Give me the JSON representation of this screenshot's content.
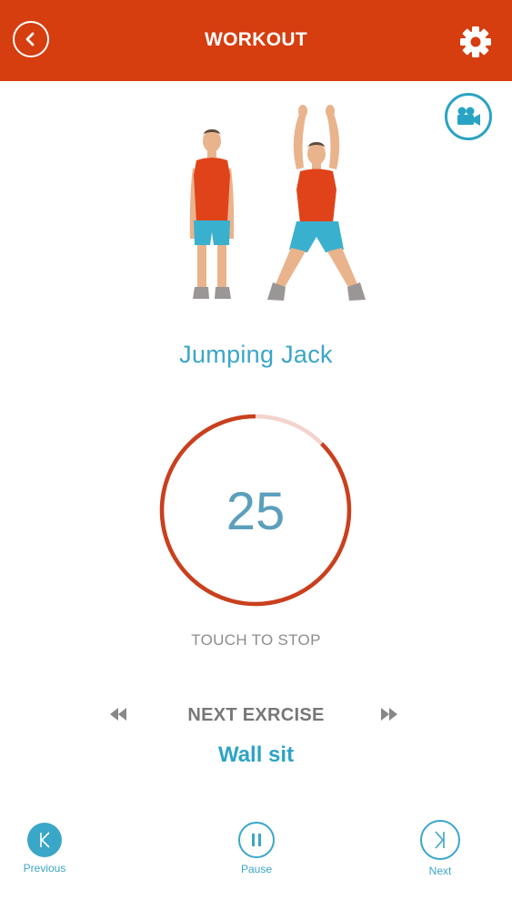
{
  "header": {
    "title": "WORKOUT",
    "background": "#d63d0f",
    "back_icon": "chevron-left-icon",
    "settings_icon": "gear-icon"
  },
  "video_button": {
    "icon": "video-camera-icon",
    "color": "#29a3c4"
  },
  "exercise": {
    "name": "Jumping Jack",
    "timer_value": "25",
    "timer_progress": 0.875,
    "touch_label": "TOUCH TO STOP"
  },
  "next": {
    "label": "NEXT EXRCISE",
    "name": "Wall sit",
    "prev_icon": "rewind-icon",
    "next_icon": "fast-forward-icon"
  },
  "controls": {
    "previous_label": "Previous",
    "pause_label": "Pause",
    "next_label": "Next"
  },
  "colors": {
    "accent": "#3aa6c8",
    "ring": "#c9401e",
    "ring_track": "#f2d4cc"
  }
}
